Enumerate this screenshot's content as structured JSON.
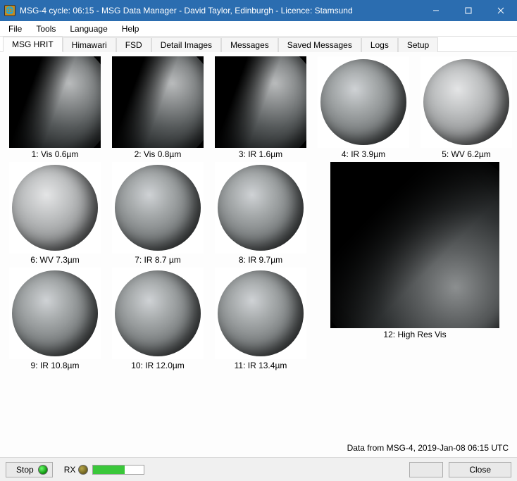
{
  "titlebar": {
    "text": "MSG-4 cycle: 06:15 - MSG Data Manager - David Taylor, Edinburgh - Licence: Stamsund"
  },
  "menu": {
    "items": [
      "File",
      "Tools",
      "Language",
      "Help"
    ]
  },
  "tabs": [
    {
      "label": "MSG HRIT",
      "active": true
    },
    {
      "label": "Himawari",
      "active": false
    },
    {
      "label": "FSD",
      "active": false
    },
    {
      "label": "Detail Images",
      "active": false
    },
    {
      "label": "Messages",
      "active": false
    },
    {
      "label": "Saved Messages",
      "active": false
    },
    {
      "label": "Logs",
      "active": false
    },
    {
      "label": "Setup",
      "active": false
    }
  ],
  "channels": [
    {
      "caption": "1:  Vis 0.6µm",
      "style": "visdisc"
    },
    {
      "caption": "2:  Vis 0.8µm",
      "style": "visdisc"
    },
    {
      "caption": "3:  IR 1.6µm",
      "style": "visdisc"
    },
    {
      "caption": "4:  IR 3.9µm",
      "style": "whitebg"
    },
    {
      "caption": "5:  WV 6.2µm",
      "style": "whitebg smooth"
    },
    {
      "caption": "6:  WV 7.3µm",
      "style": "whitebg smooth"
    },
    {
      "caption": "7:  IR 8.7 µm",
      "style": "whitebg"
    },
    {
      "caption": "8:  IR 9.7µm",
      "style": "whitebg"
    },
    {
      "caption": "9:  IR 10.8µm",
      "style": "whitebg"
    },
    {
      "caption": "10:  IR 12.0µm",
      "style": "whitebg"
    },
    {
      "caption": "11:  IR 13.4µm",
      "style": "whitebg"
    }
  ],
  "big_channel": {
    "caption": "12:  High Res Vis"
  },
  "status": "Data from MSG-4,  2019-Jan-08  06:15 UTC",
  "bottom": {
    "stop_label": "Stop",
    "rx_label": "RX",
    "close_label": "Close"
  }
}
